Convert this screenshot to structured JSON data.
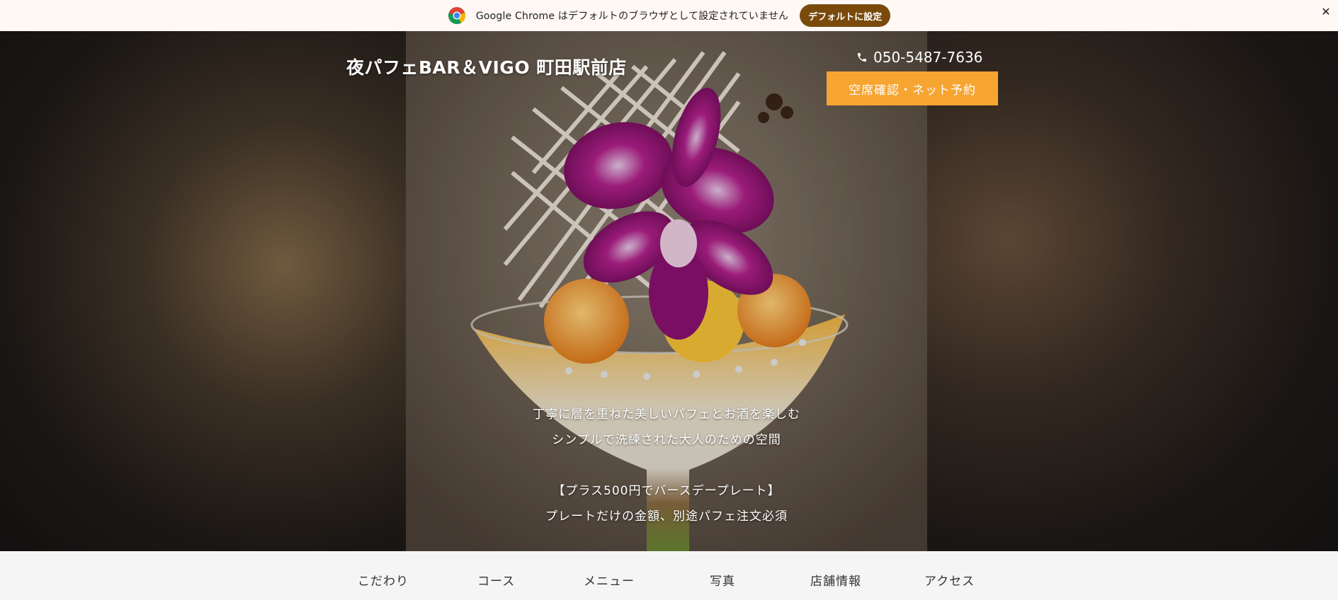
{
  "infobar": {
    "message": "Google Chrome はデフォルトのブラウザとして設定されていません",
    "button_label": "デフォルトに設定",
    "close_label": "✕"
  },
  "header": {
    "shop_name": "夜パフェBAR＆VIGO 町田駅前店",
    "phone": "050-5487-7636",
    "reserve_label": "空席確認・ネット予約"
  },
  "hero": {
    "lines": [
      "丁寧に層を重ねた美しいパフェとお酒を楽しむ",
      "シンプルで洗練された大人のための空間",
      "【プラス500円でバースデープレート】",
      "プレートだけの金額、別途パフェ注文必須"
    ]
  },
  "nav": {
    "items": [
      "こだわり",
      "コース",
      "メニュー",
      "写真",
      "店舗情報",
      "アクセス"
    ]
  },
  "colors": {
    "accent": "#f7a531",
    "infobar_button": "#7a4a0c",
    "infobar_bg": "#fff8f4",
    "nav_bg": "#f5f5f5"
  },
  "icons": {
    "infobar": "chrome-logo-icon",
    "phone": "phone-icon",
    "close": "close-icon"
  }
}
